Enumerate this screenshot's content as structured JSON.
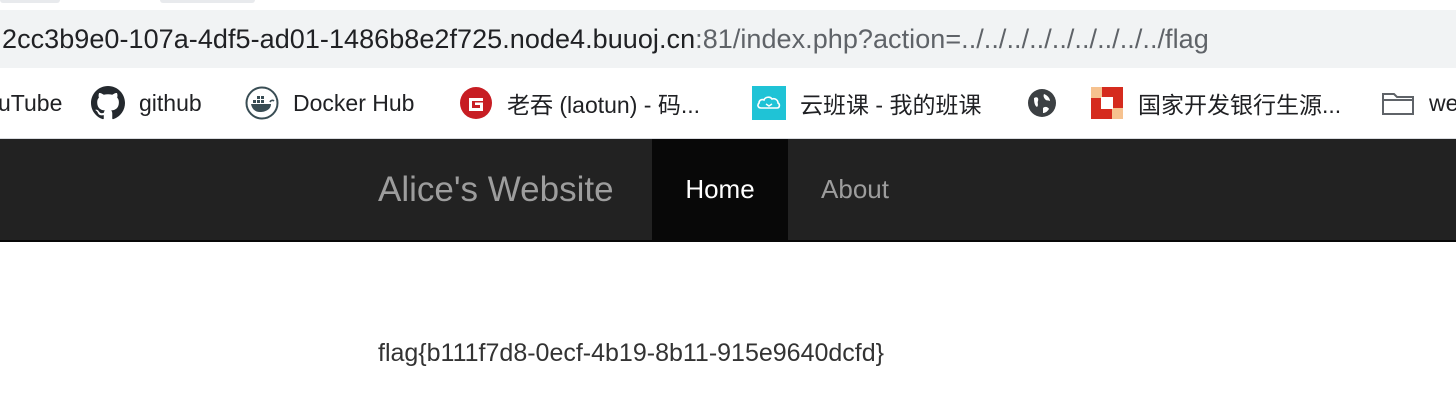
{
  "browser": {
    "url_host": "2cc3b9e0-107a-4df5-ad01-1486b8e2f725.node4.buuoj.cn",
    "url_path": ":81/index.php?action=../../../../../../../../../flag"
  },
  "bookmarks": [
    {
      "label": "uTube",
      "icon": "youtube-icon"
    },
    {
      "label": "github",
      "icon": "github-icon"
    },
    {
      "label": "Docker Hub",
      "icon": "docker-icon"
    },
    {
      "label": "老吞 (laotun) - 码...",
      "icon": "gitee-icon"
    },
    {
      "label": "云班课 - 我的班课",
      "icon": "cloud-class-icon"
    },
    {
      "label": "",
      "icon": "globe-icon"
    },
    {
      "label": "国家开发银行生源...",
      "icon": "cdb-icon"
    },
    {
      "label": "we",
      "icon": "folder-icon"
    }
  ],
  "site": {
    "brand": "Alice's Website",
    "nav": {
      "home": "Home",
      "about": "About"
    },
    "content": "flag{b111f7d8-0ecf-4b19-8b11-915e9640dcfd}"
  },
  "colors": {
    "navbar_bg": "#222222",
    "active_nav_bg": "#080808",
    "gitee_red": "#c71d23",
    "docker_blue": "#0db7ed",
    "cloud_class_cyan": "#1fc3d6"
  }
}
